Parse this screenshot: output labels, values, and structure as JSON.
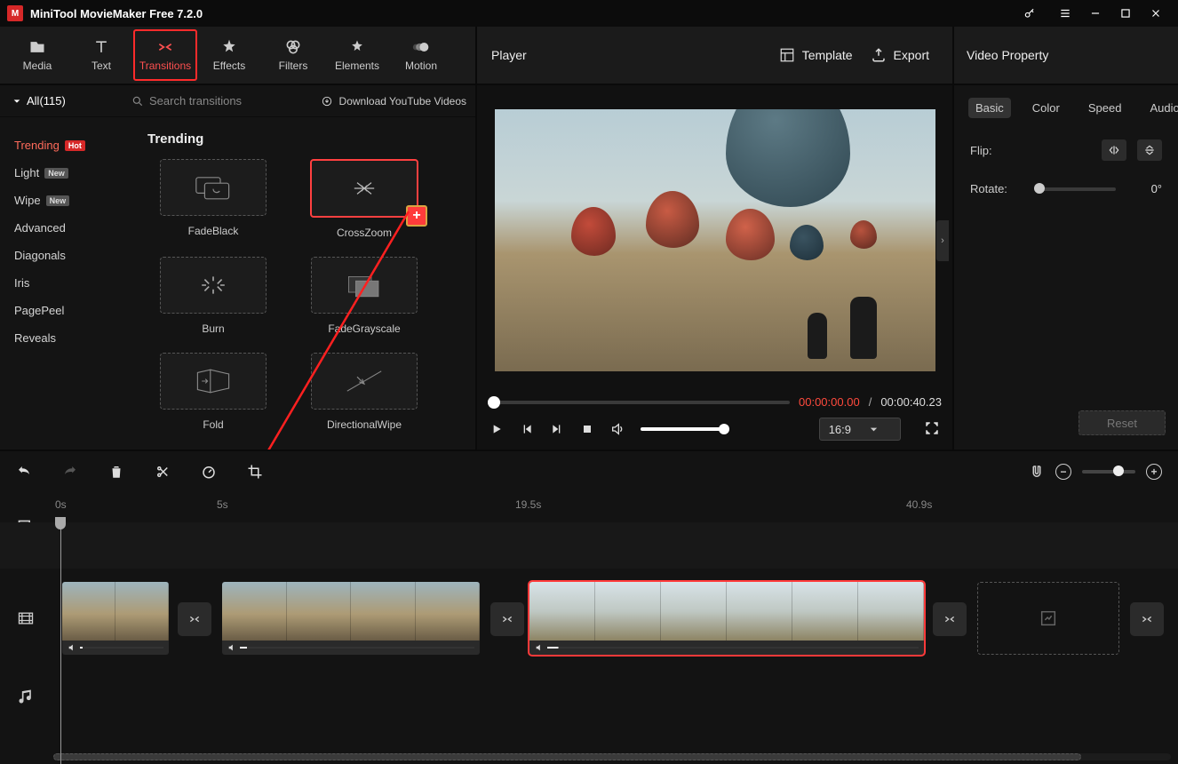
{
  "app": {
    "title": "MiniTool MovieMaker Free 7.2.0"
  },
  "toolbar": {
    "media": "Media",
    "text": "Text",
    "transitions": "Transitions",
    "effects": "Effects",
    "filters": "Filters",
    "elements": "Elements",
    "motion": "Motion"
  },
  "player": {
    "title": "Player",
    "template": "Template",
    "export": "Export",
    "current_time": "00:00:00.00",
    "duration": "00:00:40.23",
    "separator": "/",
    "ratio": "16:9"
  },
  "property": {
    "title": "Video Property",
    "tabs": {
      "basic": "Basic",
      "color": "Color",
      "speed": "Speed",
      "audio": "Audio"
    },
    "flip_label": "Flip:",
    "rotate_label": "Rotate:",
    "rotate_value": "0°",
    "reset": "Reset"
  },
  "transitions": {
    "all_label": "All(115)",
    "search_placeholder": "Search transitions",
    "download_label": "Download YouTube Videos",
    "section_title": "Trending",
    "categories": [
      {
        "label": "Trending",
        "tag": "Hot",
        "tag_class": "hot",
        "active": true
      },
      {
        "label": "Light",
        "tag": "New",
        "tag_class": "new"
      },
      {
        "label": "Wipe",
        "tag": "New",
        "tag_class": "new"
      },
      {
        "label": "Advanced"
      },
      {
        "label": "Diagonals"
      },
      {
        "label": "Iris"
      },
      {
        "label": "PagePeel"
      },
      {
        "label": "Reveals"
      }
    ],
    "items": [
      {
        "name": "FadeBlack"
      },
      {
        "name": "CrossZoom",
        "selected": true
      },
      {
        "name": "Burn"
      },
      {
        "name": "FadeGrayscale"
      },
      {
        "name": "Fold"
      },
      {
        "name": "DirectionalWipe"
      }
    ]
  },
  "timeline": {
    "ticks": [
      "0s",
      "5s",
      "19.5s",
      "40.9s"
    ]
  }
}
